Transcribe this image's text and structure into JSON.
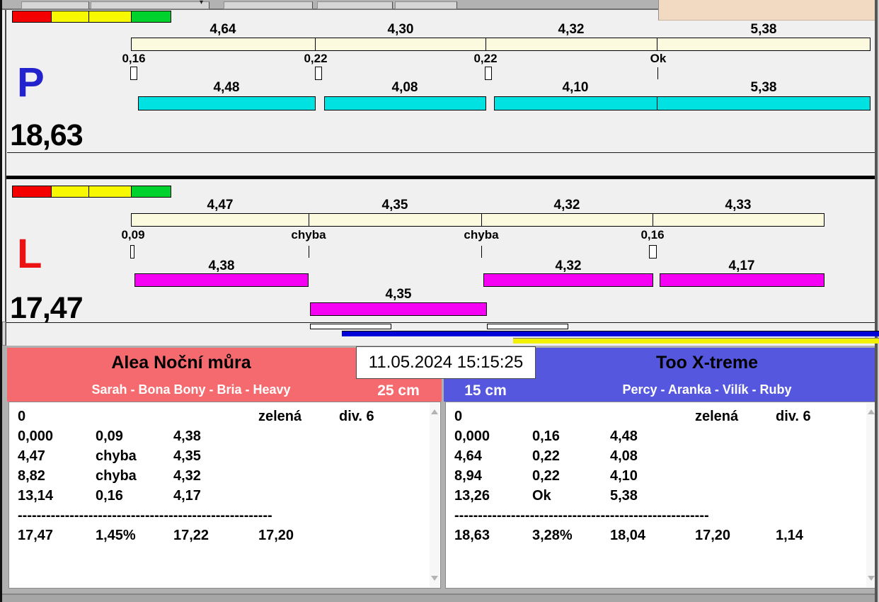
{
  "topbar": {
    "dropdown_arrow": "▾"
  },
  "runs": {
    "p": {
      "letter": "P",
      "total": "18,63",
      "laps": [
        "4,64",
        "4,30",
        "4,32",
        "5,38"
      ],
      "ticks": [
        "0,16",
        "0,22",
        "0,22",
        "Ok"
      ],
      "splits": [
        "4,48",
        "4,08",
        "4,10",
        "5,38"
      ]
    },
    "l": {
      "letter": "L",
      "total": "17,47",
      "laps": [
        "4,47",
        "4,35",
        "4,32",
        "4,33"
      ],
      "ticks": [
        "0,09",
        "chyba",
        "chyba",
        "0,16"
      ],
      "splits": [
        "4,38",
        "4,32",
        "4,17"
      ],
      "split_below": "4,35"
    }
  },
  "timestamp": "11.05.2024 15:15:25",
  "cards": {
    "left": {
      "title": "Alea Noční můra",
      "team": "Sarah - Bona Bony - Bria - Heavy",
      "height": "25 cm",
      "accent": "#f56a6e",
      "rows": [
        [
          "0",
          "",
          "",
          "zelená",
          "div. 6"
        ],
        [
          "0,000",
          "0,09",
          "4,38",
          "",
          ""
        ],
        [
          "4,47",
          "chyba",
          "4,35",
          "",
          ""
        ],
        [
          "8,82",
          "chyba",
          "4,32",
          "",
          ""
        ],
        [
          "13,14",
          "0,16",
          "4,17",
          "",
          ""
        ],
        [
          "------------------------------------------------------",
          "",
          "",
          "",
          ""
        ],
        [
          "17,47",
          "1,45%",
          "17,22",
          "17,20",
          ""
        ]
      ]
    },
    "right": {
      "title": "Too X-treme",
      "team": "Percy - Aranka - Vilík - Ruby",
      "height": "15 cm",
      "accent": "#5558de",
      "rows": [
        [
          "0",
          "",
          "",
          "zelená",
          "div. 6"
        ],
        [
          "0,000",
          "0,16",
          "4,48",
          "",
          ""
        ],
        [
          "4,64",
          "0,22",
          "4,08",
          "",
          ""
        ],
        [
          "8,94",
          "0,22",
          "4,10",
          "",
          ""
        ],
        [
          "13,26",
          "Ok",
          "5,38",
          "",
          ""
        ],
        [
          "------------------------------------------------------",
          "",
          "",
          "",
          ""
        ],
        [
          "18,63",
          "3,28%",
          "18,04",
          "17,20",
          "1,14"
        ]
      ]
    }
  },
  "colors": {
    "lap_bar": "#fbfadf",
    "p_split_bar": "#00e2e2",
    "l_split_bar": "#f502f5",
    "indicator": [
      "#f50000",
      "#f8f800",
      "#f8f800",
      "#00d22d"
    ],
    "progress_blue": "#0101d8",
    "progress_yellow": "#f2f200",
    "left_header": "#f56a6e",
    "right_header": "#5558de"
  }
}
